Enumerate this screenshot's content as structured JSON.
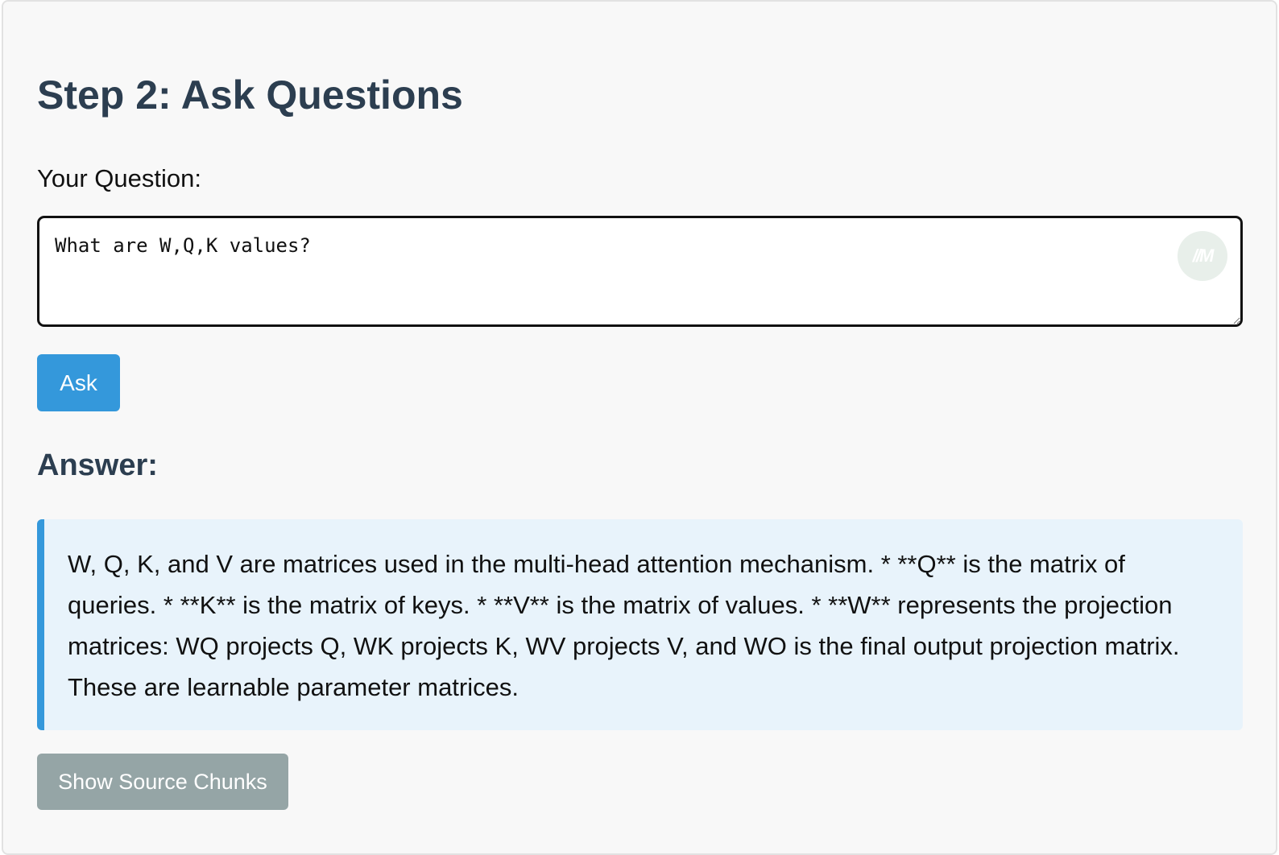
{
  "step": {
    "title": "Step 2: Ask Questions"
  },
  "question": {
    "label": "Your Question:",
    "value": "What are W,Q,K values?",
    "extension_badge": "//M"
  },
  "ask_button": {
    "label": "Ask"
  },
  "answer": {
    "heading": "Answer:",
    "text": "W, Q, K, and V are matrices used in the multi-head attention mechanism. * **Q** is the matrix of queries. * **K** is the matrix of keys. * **V** is the matrix of values. * **W** represents the projection matrices: WQ projects Q, WK projects K, WV projects V, and WO is the final output projection matrix. These are learnable parameter matrices."
  },
  "source_button": {
    "label": "Show Source Chunks"
  },
  "colors": {
    "heading": "#2c3e50",
    "accent": "#3498db",
    "answer_bg": "#e8f3fb",
    "secondary_button": "#95a5a6"
  }
}
